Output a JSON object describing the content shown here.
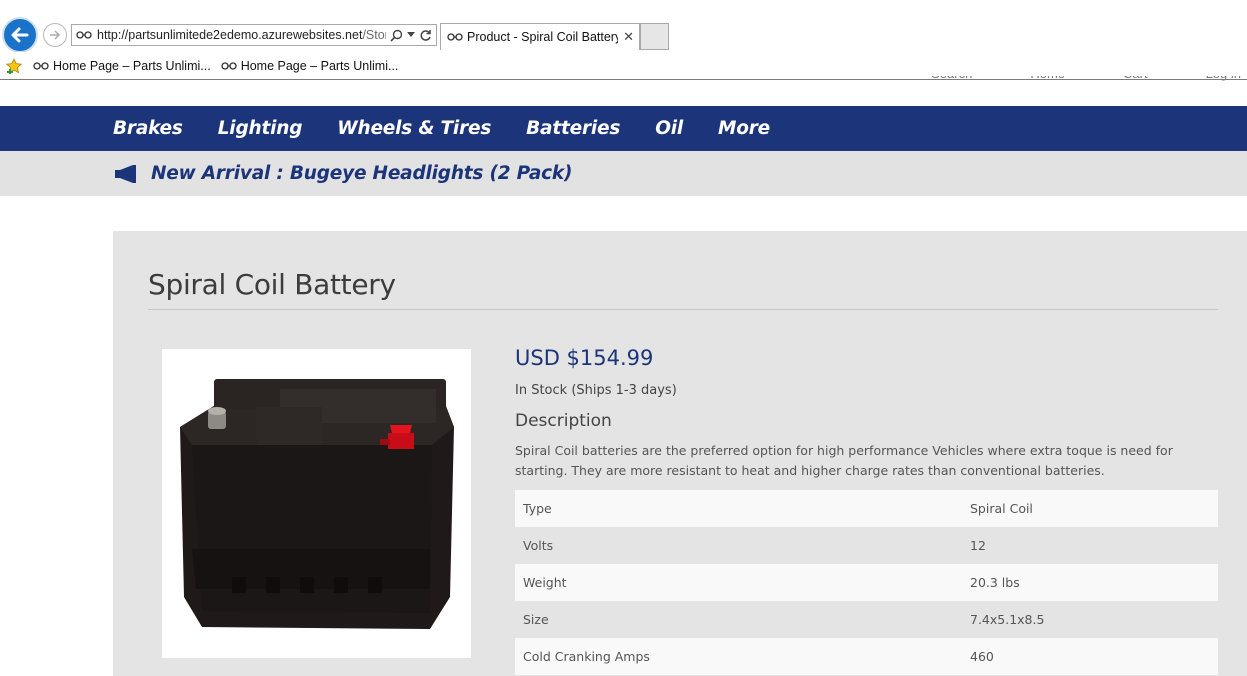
{
  "browser": {
    "url_main": "http://partsunlimitede2edemo.azurewebsites.net",
    "url_dim": "/Store",
    "tab_title": "Product - Spiral Coil Battery...",
    "favorites": [
      "Home Page – Parts Unlimi...",
      "Home Page – Parts Unlimi..."
    ]
  },
  "site_topnav": [
    "Search",
    "Home",
    "Cart",
    "Log in"
  ],
  "categories": [
    "Brakes",
    "Lighting",
    "Wheels & Tires",
    "Batteries",
    "Oil",
    "More"
  ],
  "announcement": "New Arrival : Bugeye Headlights (2 Pack)",
  "product": {
    "title": "Spiral Coil Battery",
    "price": "USD $154.99",
    "stock": "In Stock (Ships 1-3 days)",
    "description_heading": "Description",
    "description": "Spiral Coil batteries are the preferred option for high performance Vehicles where extra toque is need for starting. They are more resistant to heat and higher charge rates than conventional batteries.",
    "specs": [
      {
        "key": "Type",
        "value": "Spiral Coil"
      },
      {
        "key": "Volts",
        "value": "12"
      },
      {
        "key": "Weight",
        "value": "20.3 lbs"
      },
      {
        "key": "Size",
        "value": "7.4x5.1x8.5"
      },
      {
        "key": "Cold Cranking Amps",
        "value": "460"
      }
    ]
  },
  "colors": {
    "nav_blue": "#1c3479",
    "panel_gray": "#e4e4e4",
    "battery_cap_red": "#d8101c"
  }
}
